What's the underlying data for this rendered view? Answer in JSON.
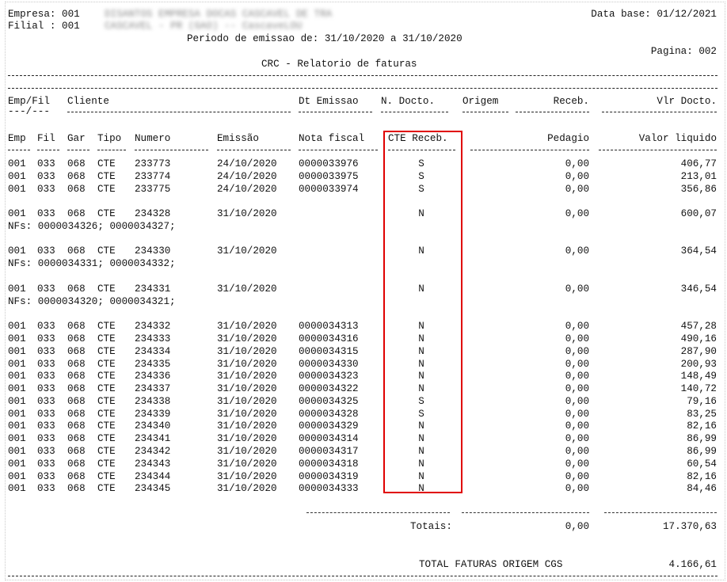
{
  "header": {
    "empresa_label": "Empresa: 001",
    "empresa_name": "DISANTOS EMPRESA DOCAS CASCAVEL DE TRA",
    "filial_label": "Filial : 001",
    "filial_name": "CASCAVEL - PR (GAO) -- CascaveLOU",
    "data_base": "Data base: 01/12/2021",
    "periodo": "Periodo de emissao de: 31/10/2020 a 31/10/2020",
    "pagina": "Pagina: 002",
    "title": "CRC - Relatorio de faturas"
  },
  "columns_top": {
    "empfil": "Emp/Fil",
    "cliente": "Cliente",
    "dt_emissao": "Dt Emissao",
    "n_docto": "N. Docto.",
    "origem": "Origem",
    "receb": "Receb.",
    "vlr_docto": "Vlr Docto.",
    "empfil_underline": "---/---"
  },
  "columns": {
    "emp": "Emp",
    "fil": "Fil",
    "gar": "Gar",
    "tipo": "Tipo",
    "numero": "Numero",
    "emissao": "Emissão",
    "nota_fiscal": "Nota fiscal",
    "cte_receb": "CTE Receb.",
    "pedagio": "Pedagio",
    "valor_liquido": "Valor liquido"
  },
  "rows": [
    {
      "emp": "001",
      "fil": "033",
      "gar": "068",
      "tipo": "CTE",
      "numero": "233773",
      "emissao": "24/10/2020",
      "nf": "0000033976",
      "cte": "S",
      "pedagio": "0,00",
      "valor": "406,77",
      "nfs": ""
    },
    {
      "emp": "001",
      "fil": "033",
      "gar": "068",
      "tipo": "CTE",
      "numero": "233774",
      "emissao": "24/10/2020",
      "nf": "0000033975",
      "cte": "S",
      "pedagio": "0,00",
      "valor": "213,01",
      "nfs": ""
    },
    {
      "emp": "001",
      "fil": "033",
      "gar": "068",
      "tipo": "CTE",
      "numero": "233775",
      "emissao": "24/10/2020",
      "nf": "0000033974",
      "cte": "S",
      "pedagio": "0,00",
      "valor": "356,86",
      "nfs": ""
    },
    {
      "emp": "001",
      "fil": "033",
      "gar": "068",
      "tipo": "CTE",
      "numero": "234328",
      "emissao": "31/10/2020",
      "nf": "",
      "cte": "N",
      "pedagio": "0,00",
      "valor": "600,07",
      "nfs": "NFs: 0000034326; 0000034327;"
    },
    {
      "emp": "001",
      "fil": "033",
      "gar": "068",
      "tipo": "CTE",
      "numero": "234330",
      "emissao": "31/10/2020",
      "nf": "",
      "cte": "N",
      "pedagio": "0,00",
      "valor": "364,54",
      "nfs": "NFs: 0000034331; 0000034332;"
    },
    {
      "emp": "001",
      "fil": "033",
      "gar": "068",
      "tipo": "CTE",
      "numero": "234331",
      "emissao": "31/10/2020",
      "nf": "",
      "cte": "N",
      "pedagio": "0,00",
      "valor": "346,54",
      "nfs": "NFs: 0000034320; 0000034321;"
    },
    {
      "emp": "001",
      "fil": "033",
      "gar": "068",
      "tipo": "CTE",
      "numero": "234332",
      "emissao": "31/10/2020",
      "nf": "0000034313",
      "cte": "N",
      "pedagio": "0,00",
      "valor": "457,28",
      "nfs": ""
    },
    {
      "emp": "001",
      "fil": "033",
      "gar": "068",
      "tipo": "CTE",
      "numero": "234333",
      "emissao": "31/10/2020",
      "nf": "0000034316",
      "cte": "N",
      "pedagio": "0,00",
      "valor": "490,16",
      "nfs": ""
    },
    {
      "emp": "001",
      "fil": "033",
      "gar": "068",
      "tipo": "CTE",
      "numero": "234334",
      "emissao": "31/10/2020",
      "nf": "0000034315",
      "cte": "N",
      "pedagio": "0,00",
      "valor": "287,90",
      "nfs": ""
    },
    {
      "emp": "001",
      "fil": "033",
      "gar": "068",
      "tipo": "CTE",
      "numero": "234335",
      "emissao": "31/10/2020",
      "nf": "0000034330",
      "cte": "N",
      "pedagio": "0,00",
      "valor": "200,93",
      "nfs": ""
    },
    {
      "emp": "001",
      "fil": "033",
      "gar": "068",
      "tipo": "CTE",
      "numero": "234336",
      "emissao": "31/10/2020",
      "nf": "0000034323",
      "cte": "N",
      "pedagio": "0,00",
      "valor": "148,49",
      "nfs": ""
    },
    {
      "emp": "001",
      "fil": "033",
      "gar": "068",
      "tipo": "CTE",
      "numero": "234337",
      "emissao": "31/10/2020",
      "nf": "0000034322",
      "cte": "N",
      "pedagio": "0,00",
      "valor": "140,72",
      "nfs": ""
    },
    {
      "emp": "001",
      "fil": "033",
      "gar": "068",
      "tipo": "CTE",
      "numero": "234338",
      "emissao": "31/10/2020",
      "nf": "0000034325",
      "cte": "S",
      "pedagio": "0,00",
      "valor": "79,16",
      "nfs": ""
    },
    {
      "emp": "001",
      "fil": "033",
      "gar": "068",
      "tipo": "CTE",
      "numero": "234339",
      "emissao": "31/10/2020",
      "nf": "0000034328",
      "cte": "S",
      "pedagio": "0,00",
      "valor": "83,25",
      "nfs": ""
    },
    {
      "emp": "001",
      "fil": "033",
      "gar": "068",
      "tipo": "CTE",
      "numero": "234340",
      "emissao": "31/10/2020",
      "nf": "0000034329",
      "cte": "N",
      "pedagio": "0,00",
      "valor": "82,16",
      "nfs": ""
    },
    {
      "emp": "001",
      "fil": "033",
      "gar": "068",
      "tipo": "CTE",
      "numero": "234341",
      "emissao": "31/10/2020",
      "nf": "0000034314",
      "cte": "N",
      "pedagio": "0,00",
      "valor": "86,99",
      "nfs": ""
    },
    {
      "emp": "001",
      "fil": "033",
      "gar": "068",
      "tipo": "CTE",
      "numero": "234342",
      "emissao": "31/10/2020",
      "nf": "0000034317",
      "cte": "N",
      "pedagio": "0,00",
      "valor": "86,99",
      "nfs": ""
    },
    {
      "emp": "001",
      "fil": "033",
      "gar": "068",
      "tipo": "CTE",
      "numero": "234343",
      "emissao": "31/10/2020",
      "nf": "0000034318",
      "cte": "N",
      "pedagio": "0,00",
      "valor": "60,54",
      "nfs": ""
    },
    {
      "emp": "001",
      "fil": "033",
      "gar": "068",
      "tipo": "CTE",
      "numero": "234344",
      "emissao": "31/10/2020",
      "nf": "0000034319",
      "cte": "N",
      "pedagio": "0,00",
      "valor": "82,16",
      "nfs": ""
    },
    {
      "emp": "001",
      "fil": "033",
      "gar": "068",
      "tipo": "CTE",
      "numero": "234345",
      "emissao": "31/10/2020",
      "nf": "0000034333",
      "cte": "N",
      "pedagio": "0,00",
      "valor": "84,46",
      "nfs": ""
    }
  ],
  "totals": {
    "label": "Totais:",
    "pedagio": "0,00",
    "valor": "17.370,63"
  },
  "grand_total": {
    "label": "TOTAL FATURAS ORIGEM CGS",
    "value": "4.166,61"
  },
  "highlight_color": "#e00000"
}
